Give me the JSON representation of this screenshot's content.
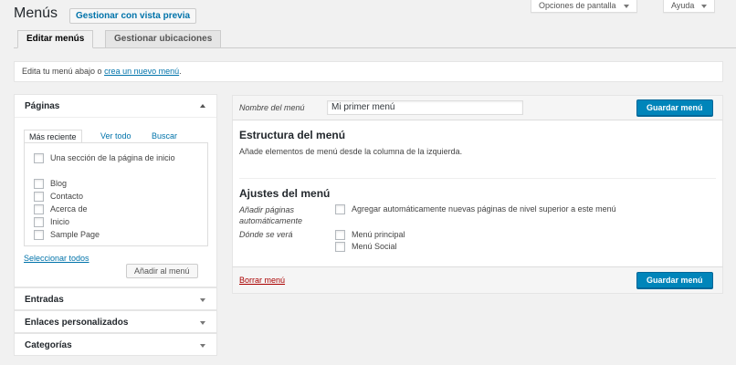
{
  "header": {
    "title": "Menús",
    "manage_preview": "Gestionar con vista previa",
    "screen_options": "Opciones de pantalla",
    "help": "Ayuda"
  },
  "tabs": [
    "Editar menús",
    "Gestionar ubicaciones"
  ],
  "notice": {
    "prefix": "Edita tu menú abajo o ",
    "link": "crea un nuevo menú",
    "suffix": "."
  },
  "sidebar": {
    "pages_title": "Páginas",
    "inner_tabs": [
      "Más reciente",
      "Ver todo",
      "Buscar"
    ],
    "pages": [
      "Una sección de la página de inicio",
      "Blog",
      "Contacto",
      "Acerca de",
      "Inicio",
      "Sample Page"
    ],
    "select_all": "Seleccionar todos",
    "add_button": "Añadir al menú",
    "sections": [
      "Entradas",
      "Enlaces personalizados",
      "Categorías"
    ]
  },
  "menu": {
    "name_label": "Nombre del menú",
    "name_value": "Mi primer menú",
    "save_label": "Guardar menú",
    "structure_title": "Estructura del menú",
    "structure_desc": "Añade elementos de menú desde la columna de la izquierda.",
    "settings_title": "Ajustes del menú",
    "auto_add_label": "Añadir páginas automáticamente",
    "auto_add_option": "Agregar automáticamente nuevas páginas de nivel superior a este menú",
    "display_label": "Dónde se verá",
    "locations": [
      "Menú principal",
      "Menú Social"
    ],
    "delete_label": "Borrar menú"
  }
}
